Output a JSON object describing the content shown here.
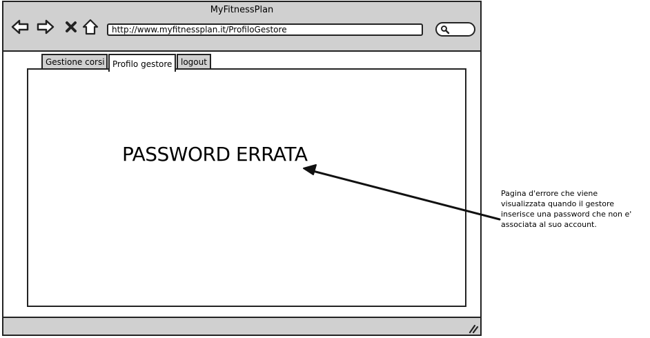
{
  "window": {
    "title": "MyFitnessPlan"
  },
  "toolbar": {
    "url": "http://www.myfitnessplan.it/ProfiloGestore",
    "icons": {
      "back": "arrow-left-icon",
      "forward": "arrow-right-icon",
      "stop": "close-icon",
      "home": "home-icon",
      "search": "search-icon"
    }
  },
  "tabs": [
    {
      "label": "Gestione corsi",
      "active": false
    },
    {
      "label": "Profilo gestore",
      "active": true
    },
    {
      "label": "logout",
      "active": false
    }
  ],
  "main": {
    "message": "PASSWORD ERRATA"
  },
  "annotation": {
    "lines": [
      "Pagina d'errore che viene",
      "visualizzata quando il gestore",
      "inserisce una password che non e'",
      "associata al suo account."
    ]
  },
  "colors": {
    "chrome": "#d0d0d0",
    "stroke": "#222222",
    "page": "#ffffff"
  }
}
